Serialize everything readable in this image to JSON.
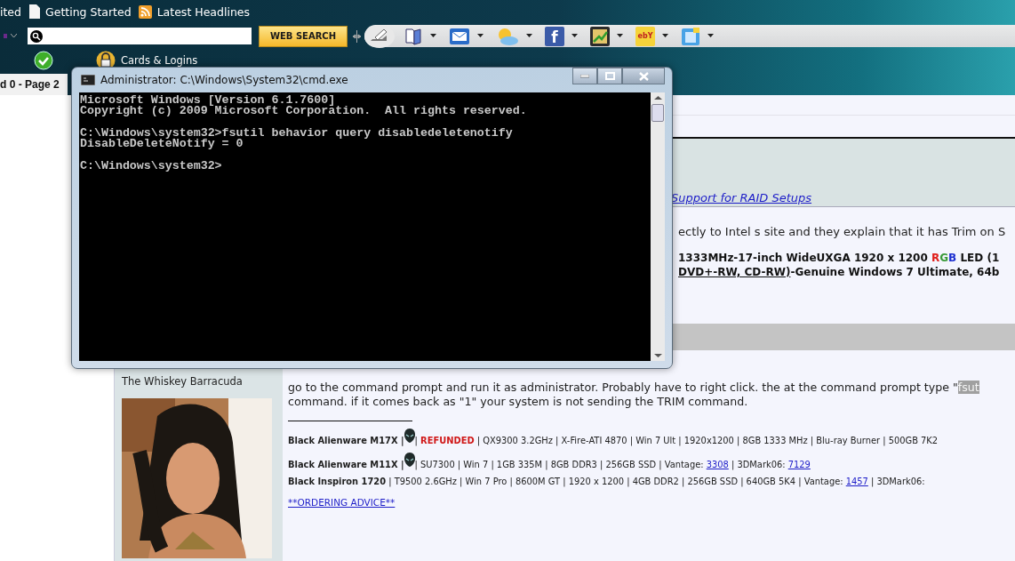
{
  "bookmarks": [
    {
      "label": "ited",
      "kind": "none"
    },
    {
      "label": "Getting Started",
      "kind": "page"
    },
    {
      "label": "Latest Headlines",
      "kind": "feed"
    }
  ],
  "toolbar": {
    "search_button": "WEB SEARCH",
    "items": [
      {
        "kind": "book"
      },
      {
        "kind": "mail"
      },
      {
        "kind": "weather"
      },
      {
        "kind": "letter",
        "label": "f"
      },
      {
        "kind": "chart"
      },
      {
        "kind": "letter2",
        "label": "ebY"
      },
      {
        "kind": "phone"
      }
    ],
    "cards_label": "Cards & Logins"
  },
  "tab": {
    "label": "d 0 - Page 2",
    "selected": true
  },
  "page": {
    "link": "Support for RAID Setups",
    "post_excerpt": "ectly to Intel s site and they explain that it has Trim on S",
    "specs": [
      [
        {
          "kind": "plain",
          "text": "1333MHz-17-inch WideUXGA 1920 x 1200 "
        },
        {
          "kind": "colored",
          "text": "R",
          "color": "#e0201c"
        },
        {
          "kind": "colored",
          "text": "G",
          "color": "#3a9a3a"
        },
        {
          "kind": "colored",
          "text": "B",
          "color": "#1c2fd0"
        },
        {
          "kind": "plain",
          "text": " LED (1"
        }
      ],
      [
        {
          "kind": "underlined",
          "text": " DVD+-RW, CD-RW)"
        },
        {
          "kind": "plain",
          "text": "-Genuine Windows 7 Ultimate, 64b"
        }
      ]
    ],
    "username": "The Whiskey Barracuda",
    "post": {
      "line1": "go to the command prompt and run it as administrator. Probably have to right click. the at the command prompt type \"",
      "highlight": "fsut",
      "line2": "command. if it comes back as \"1\" your system is not sending the TRIM command."
    },
    "signature": [
      [
        {
          "kind": "bold",
          "text": "Black Alienware M17X |"
        },
        {
          "kind": "icon"
        },
        {
          "kind": "plain",
          "text": "| "
        },
        {
          "kind": "alert",
          "text": "REFUNDED"
        },
        {
          "kind": "plain",
          "text": " | QX9300 3.2GHz | X-Fire-ATI 4870 | Win 7 Ult | 1920x1200 | 8GB 1333 MHz | Blu-ray Burner | 500GB 7K2"
        }
      ],
      [
        {
          "kind": "bold",
          "text": "Black Alienware M11X |"
        },
        {
          "kind": "icon"
        },
        {
          "kind": "plain",
          "text": "| SU7300 | Win 7 | 1GB 335M | 8GB DDR3 | 256GB SSD | Vantage: "
        },
        {
          "kind": "link",
          "text": "3308"
        },
        {
          "kind": "plain",
          "text": " | 3DMark06: "
        },
        {
          "kind": "link",
          "text": "7129"
        }
      ],
      [
        {
          "kind": "bold",
          "text": "Black Inspiron 1720"
        },
        {
          "kind": "plain",
          "text": " | T9500 2.6GHz | Win 7 Pro | 8600M GT | 1920 x 1200 | 4GB DDR2 | 256GB SSD | 640GB 5K4 | Vantage: "
        },
        {
          "kind": "link",
          "text": "1457"
        },
        {
          "kind": "plain",
          "text": " | 3DMark06:"
        }
      ]
    ],
    "ordering_link": "**ORDERING ADVICE**"
  },
  "console": {
    "title": "Administrator: C:\\Windows\\System32\\cmd.exe",
    "blocks": [
      [
        "Microsoft Windows [Version 6.1.7600]",
        "Copyright (c) 2009 Microsoft Corporation.  All rights reserved."
      ],
      [
        "C:\\Windows\\system32>fsutil behavior query disabledeletenotify",
        "DisableDeleteNotify = 0"
      ],
      [
        "C:\\Windows\\system32>"
      ]
    ]
  }
}
